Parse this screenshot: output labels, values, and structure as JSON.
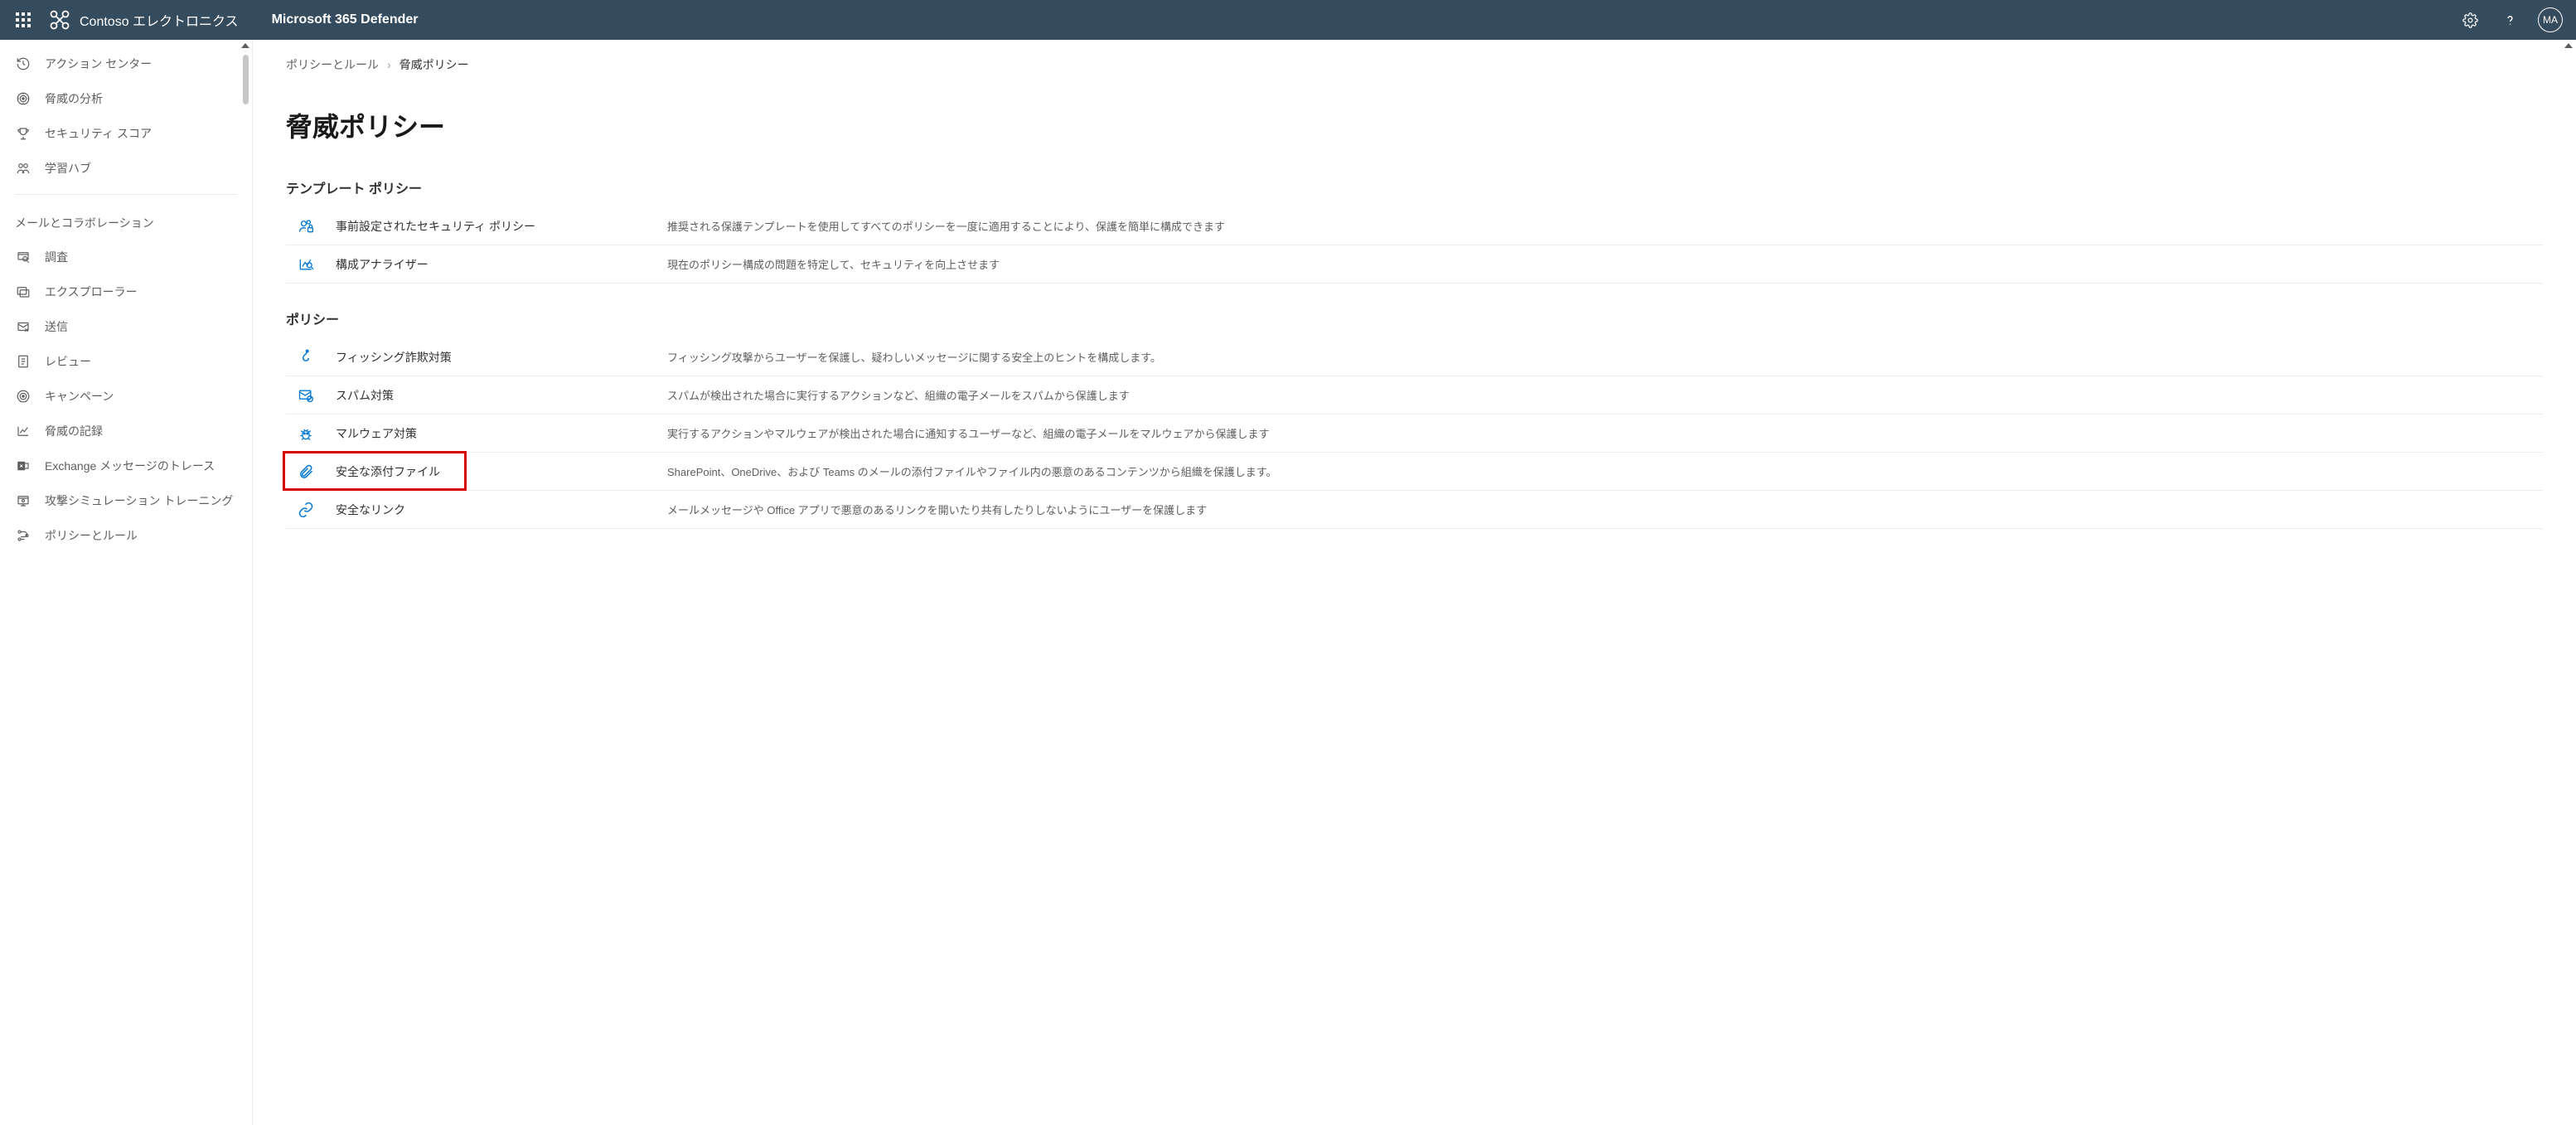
{
  "topbar": {
    "brand": "Contoso エレクトロニクス",
    "product": "Microsoft 365 Defender",
    "avatar_initials": "MA"
  },
  "sidebar": {
    "items_top": [
      {
        "icon": "history",
        "label": "アクション センター"
      },
      {
        "icon": "radar",
        "label": "脅威の分析"
      },
      {
        "icon": "trophy",
        "label": "セキュリティ スコア"
      },
      {
        "icon": "learn",
        "label": "学習ハブ"
      }
    ],
    "section_label": "メールとコラボレーション",
    "items_mail": [
      {
        "icon": "investigate",
        "label": "調査"
      },
      {
        "icon": "explorer",
        "label": "エクスプローラー"
      },
      {
        "icon": "send",
        "label": "送信"
      },
      {
        "icon": "review",
        "label": "レビュー"
      },
      {
        "icon": "campaign",
        "label": "キャンペーン"
      },
      {
        "icon": "chart",
        "label": "脅威の記録"
      },
      {
        "icon": "exchange",
        "label": "Exchange メッセージのトレース"
      },
      {
        "icon": "attack",
        "label": "攻撃シミュレーション トレーニング"
      },
      {
        "icon": "policy",
        "label": "ポリシーとルール"
      }
    ]
  },
  "breadcrumb": {
    "parent": "ポリシーとルール",
    "current": "脅威ポリシー"
  },
  "page_title": "脅威ポリシー",
  "section_templates": {
    "title": "テンプレート ポリシー",
    "rows": [
      {
        "icon": "people-lock",
        "name": "事前設定されたセキュリティ ポリシー",
        "desc": "推奨される保護テンプレートを使用してすべてのポリシーを一度に適用することにより、保護を簡単に構成できます"
      },
      {
        "icon": "analyzer",
        "name": "構成アナライザー",
        "desc": "現在のポリシー構成の問題を特定して、セキュリティを向上させます"
      }
    ]
  },
  "section_policies": {
    "title": "ポリシー",
    "rows": [
      {
        "icon": "phishing",
        "name": "フィッシング詐欺対策",
        "desc": "フィッシング攻撃からユーザーを保護し、疑わしいメッセージに関する安全上のヒントを構成します。"
      },
      {
        "icon": "spam",
        "name": "スパム対策",
        "desc": "スパムが検出された場合に実行するアクションなど、組織の電子メールをスパムから保護します"
      },
      {
        "icon": "malware",
        "name": "マルウェア対策",
        "desc": "実行するアクションやマルウェアが検出された場合に通知するユーザーなど、組織の電子メールをマルウェアから保護します"
      },
      {
        "icon": "attachment",
        "name": "安全な添付ファイル",
        "desc": "SharePoint、OneDrive、および Teams のメールの添付ファイルやファイル内の悪意のあるコンテンツから組織を保護します。",
        "highlight": true
      },
      {
        "icon": "link",
        "name": "安全なリンク",
        "desc": "メールメッセージや Office アプリで悪意のあるリンクを開いたり共有したりしないようにユーザーを保護します"
      }
    ]
  }
}
